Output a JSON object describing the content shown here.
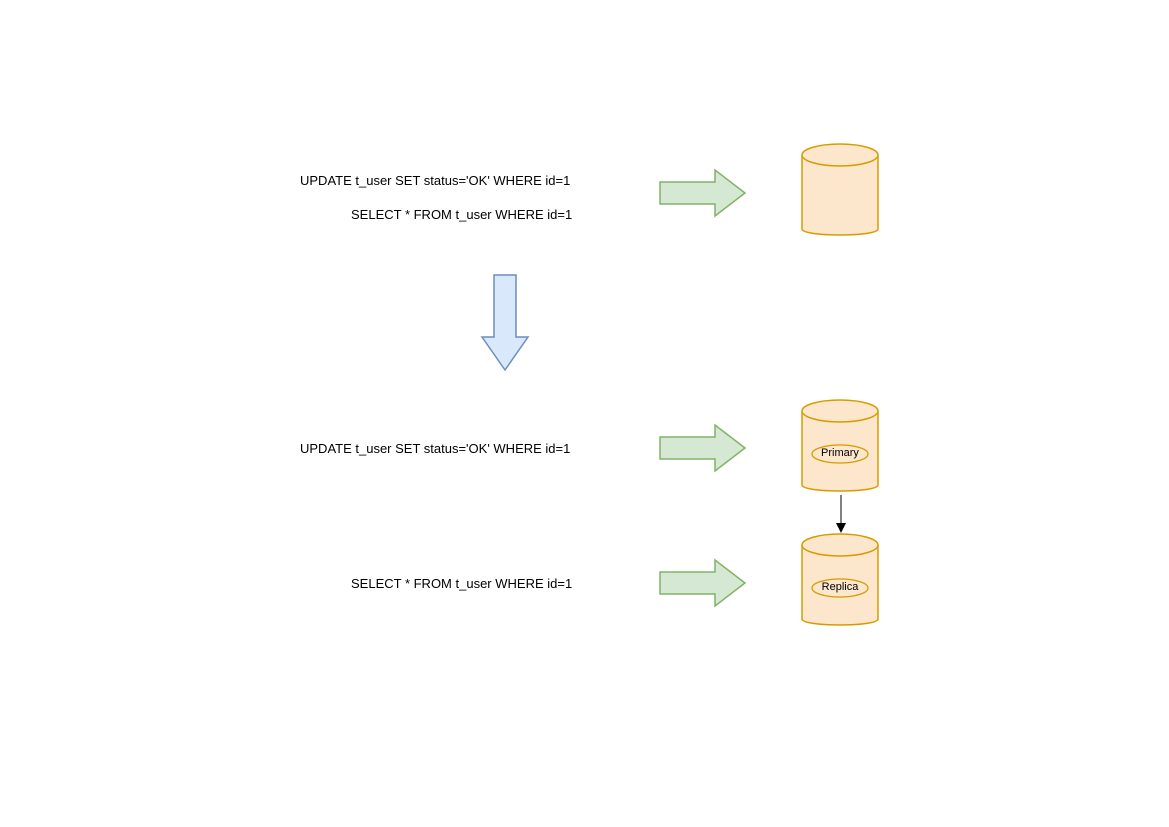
{
  "diagram": {
    "top_section": {
      "update_sql": "UPDATE t_user SET status='OK'  WHERE id=1",
      "select_sql": "SELECT * FROM t_user WHERE id=1"
    },
    "bottom_section": {
      "update_sql": "UPDATE t_user SET status='OK'  WHERE id=1",
      "select_sql": "SELECT * FROM t_user WHERE id=1",
      "primary_label": "Primary",
      "replica_label": "Replica"
    },
    "colors": {
      "db_fill": "#F8CECC_like_orange",
      "db_stroke": "#D79B00",
      "green_arrow_fill": "#D5E8D4",
      "green_arrow_stroke": "#82B366",
      "blue_arrow_fill": "#DAE8FC",
      "blue_arrow_stroke": "#6C8EBF"
    }
  }
}
